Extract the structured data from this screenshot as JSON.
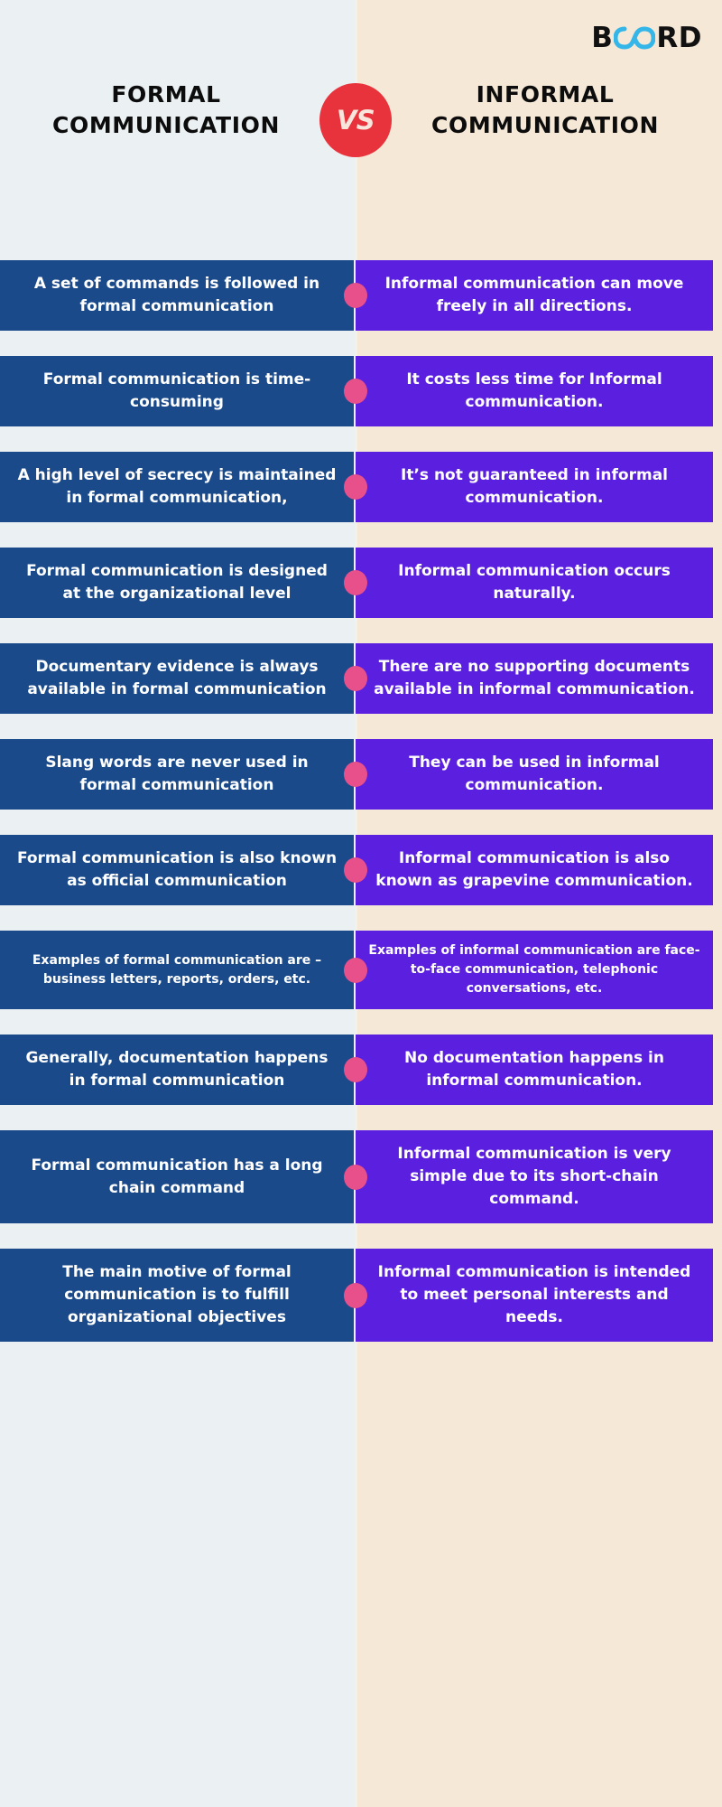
{
  "brand": {
    "name": "BOARD",
    "letters_before": "B",
    "letters_after": "RD",
    "infinity_icon": "infinity-icon",
    "text_color": "#111111",
    "accent_color": "#35B6E8"
  },
  "header": {
    "left_title": "FORMAL COMMUNICATION",
    "right_title": "INFORMAL COMMUNICATION",
    "vs_label": "VS",
    "vs_badge_color": "#E8323C"
  },
  "theme": {
    "left_background": "#EBF0F3",
    "right_background": "#F6E8D7",
    "left_bar_color": "#1B4A8B",
    "right_bar_color": "#5B1FE0",
    "connector_dot_color": "#E8508C",
    "bar_text_color": "#FFFFFF"
  },
  "comparison": {
    "rows": [
      {
        "left": "A set of commands is followed in formal communication",
        "right": "Informal communication can move freely in all directions.",
        "size": "normal"
      },
      {
        "left": "Formal communication is time-consuming",
        "right": "It costs less time for Informal communication.",
        "size": "normal"
      },
      {
        "left": "A high level of secrecy is maintained in formal communication,",
        "right": "It’s not guaranteed in informal communication.",
        "size": "normal"
      },
      {
        "left": "Formal communication is designed at the organizational level",
        "right": "Informal communication occurs naturally.",
        "size": "normal"
      },
      {
        "left": "Documentary evidence is always available in formal communication",
        "right": "There are no supporting documents available in informal communication.",
        "size": "normal"
      },
      {
        "left": "Slang words are never used in formal communication",
        "right": "They can be used in informal communication.",
        "size": "normal"
      },
      {
        "left": "Formal communication is also known as official communication",
        "right": "Informal communication is also known as grapevine communication.",
        "size": "normal"
      },
      {
        "left": "Examples of formal communication are – business letters, reports, orders, etc.",
        "right": "Examples of informal communication are face-to-face communication, telephonic conversations, etc.",
        "size": "small"
      },
      {
        "left": "Generally, documentation happens in formal communication",
        "right": "No documentation happens in informal communication.",
        "size": "normal"
      },
      {
        "left": "Formal communication has a long chain command",
        "right": "Informal communication is very simple due to its short-chain command.",
        "size": "normal"
      },
      {
        "left": "The main motive of formal communication is to fulfill organizational objectives",
        "right": "Informal communication is intended to meet personal interests and needs.",
        "size": "normal"
      }
    ]
  }
}
